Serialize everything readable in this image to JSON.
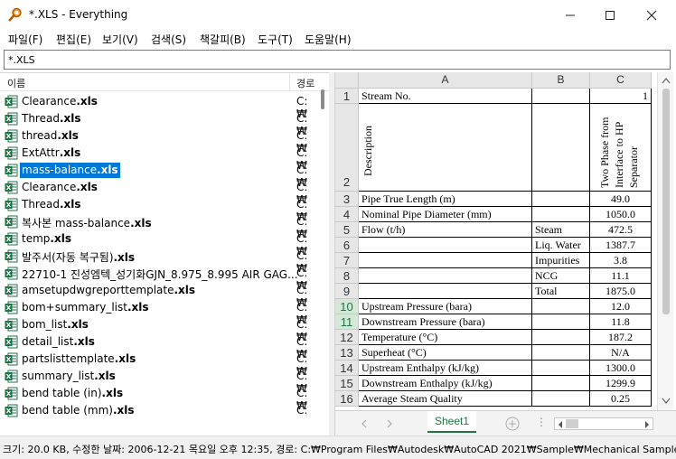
{
  "window": {
    "title": "*.XLS - Everything"
  },
  "menu": [
    {
      "key": "file",
      "label": "파일(F)"
    },
    {
      "key": "edit",
      "label": "편집(E)"
    },
    {
      "key": "view",
      "label": "보기(V)"
    },
    {
      "key": "search",
      "label": "검색(S)"
    },
    {
      "key": "bookmarks",
      "label": "책갈피(B)"
    },
    {
      "key": "tools",
      "label": "도구(T)"
    },
    {
      "key": "help",
      "label": "도움말(H)"
    }
  ],
  "search": {
    "value": "*.XLS"
  },
  "columns": {
    "name": "이름",
    "path": "경로"
  },
  "files": [
    {
      "stem": "Clearance",
      "ext": ".xls",
      "path": "C:₩"
    },
    {
      "stem": "Thread",
      "ext": ".xls",
      "path": "C:₩"
    },
    {
      "stem": "thread",
      "ext": ".xls",
      "path": "C:₩"
    },
    {
      "stem": "ExtAttr",
      "ext": ".xls",
      "path": "C:₩"
    },
    {
      "stem": "mass-balance",
      "ext": ".xls",
      "path": "C:₩",
      "selected": true
    },
    {
      "stem": "Clearance",
      "ext": ".xls",
      "path": "C:₩"
    },
    {
      "stem": "Thread",
      "ext": ".xls",
      "path": "C:₩"
    },
    {
      "stem": "복사본 mass-balance",
      "ext": ".xls",
      "path": "C:₩"
    },
    {
      "stem": "temp",
      "ext": ".xls",
      "path": "C:₩"
    },
    {
      "stem": "발주서(자동 복구됨)",
      "ext": ".xls",
      "path": "C:₩"
    },
    {
      "stem": "22710-1 진성엠텍_성기화GJN_8.975_8.995 AIR GAG...",
      "ext": "",
      "path": "C:₩"
    },
    {
      "stem": "amsetupdwgreporttemplate",
      "ext": ".xls",
      "path": "C:₩"
    },
    {
      "stem": "bom+summary_list",
      "ext": ".xls",
      "path": "C:₩"
    },
    {
      "stem": "bom_list",
      "ext": ".xls",
      "path": "C:₩"
    },
    {
      "stem": "detail_list",
      "ext": ".xls",
      "path": "C:₩"
    },
    {
      "stem": "partslisttemplate",
      "ext": ".xls",
      "path": "C:₩"
    },
    {
      "stem": "summary_list",
      "ext": ".xls",
      "path": "C:₩"
    },
    {
      "stem": "bend table (in)",
      "ext": ".xls",
      "path": "C:₩"
    },
    {
      "stem": "bend table (mm)",
      "ext": ".xls",
      "path": "C:₩"
    }
  ],
  "sheet": {
    "columns": [
      "A",
      "B",
      "C"
    ],
    "tab": "Sheet1",
    "rows": [
      {
        "n": "1",
        "a": "Stream No.",
        "b": "",
        "c": "1"
      },
      {
        "n": "2",
        "a": "Description",
        "b": "",
        "c": "Two Phase from Interface to HP Separator"
      },
      {
        "n": "3",
        "a": "Pipe True Length (m)",
        "b": "",
        "c": "49.0"
      },
      {
        "n": "4",
        "a": "Nominal Pipe Diameter (mm)",
        "b": "",
        "c": "1050.0"
      },
      {
        "n": "5",
        "a": "Flow (t/h)",
        "b": "Steam",
        "c": "472.5"
      },
      {
        "n": "6",
        "a": "",
        "b": "Liq. Water",
        "c": "1387.7"
      },
      {
        "n": "7",
        "a": "",
        "b": "Impurities",
        "c": "3.8"
      },
      {
        "n": "8",
        "a": "",
        "b": "NCG",
        "c": "11.1"
      },
      {
        "n": "9",
        "a": "",
        "b": "Total",
        "c": "1875.0"
      },
      {
        "n": "10",
        "a": "Upstream Pressure (bara)",
        "b": "",
        "c": "12.0"
      },
      {
        "n": "11",
        "a": "Downstream Pressure (bara)",
        "b": "",
        "c": "11.8"
      },
      {
        "n": "12",
        "a": "Temperature (°C)",
        "b": "",
        "c": "187.2"
      },
      {
        "n": "13",
        "a": "Superheat (°C)",
        "b": "",
        "c": "N/A"
      },
      {
        "n": "14",
        "a": "Upstream Enthalpy (kJ/kg)",
        "b": "",
        "c": "1300.0"
      },
      {
        "n": "15",
        "a": "Downstream Enthalpy (kJ/kg)",
        "b": "",
        "c": "1299.9"
      },
      {
        "n": "16",
        "a": "Average Steam Quality",
        "b": "",
        "c": "0.25"
      }
    ]
  },
  "status": "크기: 20.0 KB, 수정한 날짜: 2006-12-21 목요일 오후 12:35, 경로: C:₩Program Files₩Autodesk₩AutoCAD 2021₩Sample₩Mechanical Sample"
}
